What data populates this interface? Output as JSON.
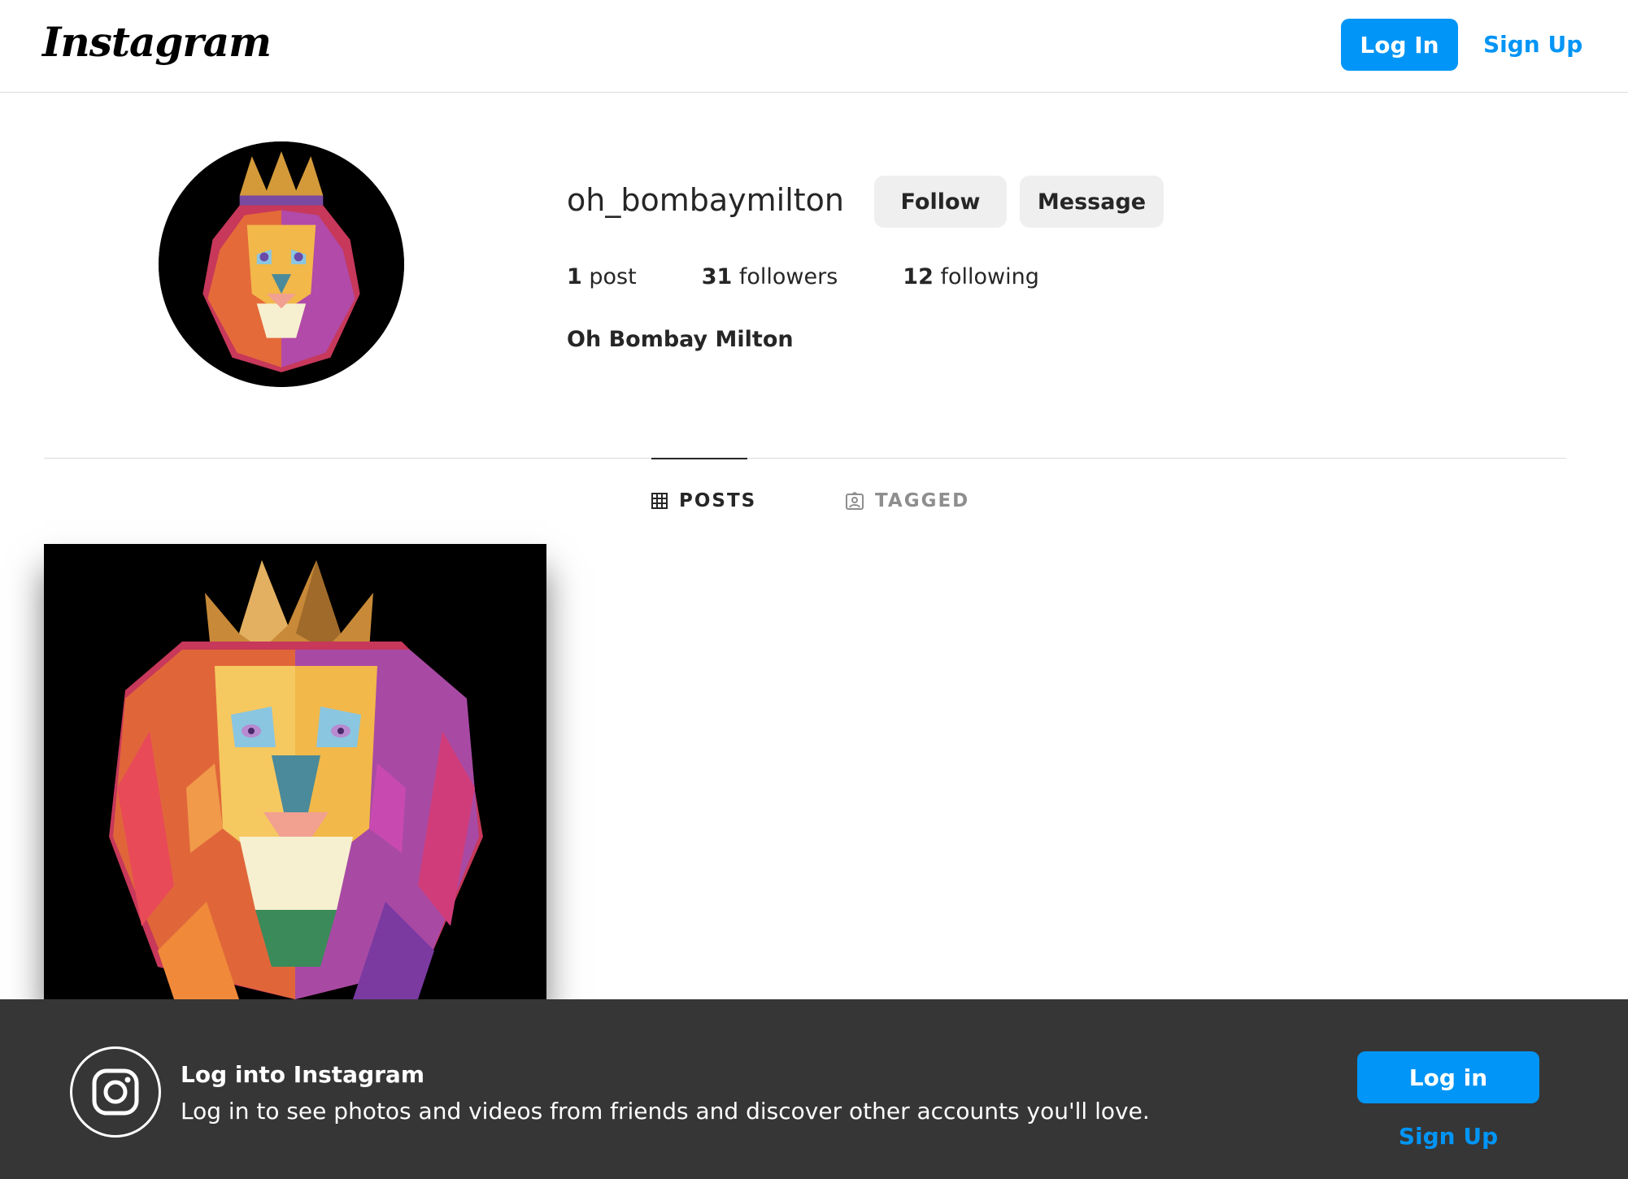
{
  "header": {
    "logo_text": "Instagram",
    "login_label": "Log In",
    "signup_label": "Sign Up"
  },
  "profile": {
    "username": "oh_bombaymilton",
    "follow_label": "Follow",
    "message_label": "Message",
    "stats": {
      "posts_count": "1",
      "posts_label": "post",
      "followers_count": "31",
      "followers_label": "followers",
      "following_count": "12",
      "following_label": "following"
    },
    "full_name": "Oh Bombay Milton",
    "avatar_icon": "lion-avatar"
  },
  "tabs": [
    {
      "label": "POSTS",
      "icon": "grid-icon",
      "active": true
    },
    {
      "label": "TAGGED",
      "icon": "tagged-icon",
      "active": false
    }
  ],
  "posts": [
    {
      "icon": "lion-post-image"
    }
  ],
  "banner": {
    "title": "Log into Instagram",
    "subtitle": "Log in to see photos and videos from friends and discover other accounts you'll love.",
    "login_label": "Log in",
    "signup_label": "Sign Up"
  },
  "colors": {
    "accent": "#0095f6",
    "banner_bg": "#363636",
    "button_gray": "#efefef"
  }
}
